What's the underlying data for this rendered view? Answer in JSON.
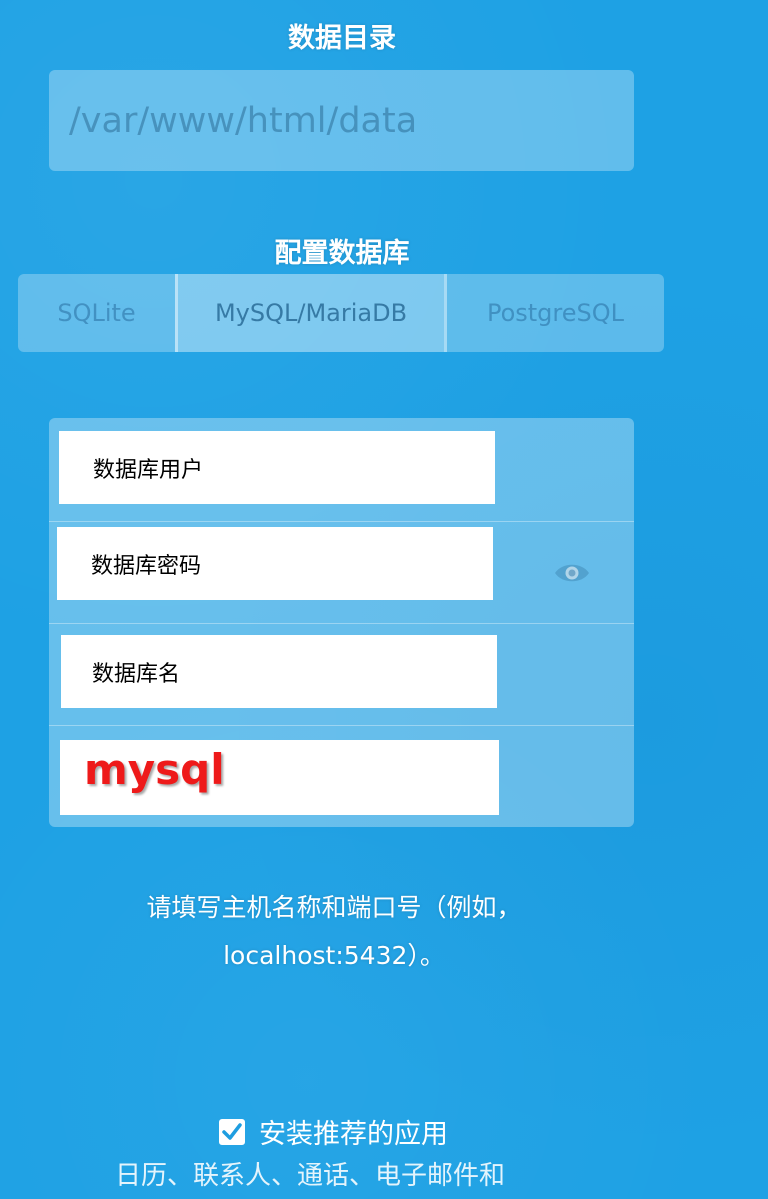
{
  "data_directory": {
    "title": "数据目录",
    "placeholder": "/var/www/html/data"
  },
  "database": {
    "title": "配置数据库",
    "tabs": [
      {
        "label": "SQLite",
        "active": false
      },
      {
        "label": "MySQL/MariaDB",
        "active": true
      },
      {
        "label": "PostgreSQL",
        "active": false
      }
    ],
    "fields": {
      "user_label": "数据库用户",
      "password_label": "数据库密码",
      "name_label": "数据库名",
      "host_value": "mysql"
    },
    "password_toggle_icon": "eye-icon"
  },
  "hint": {
    "line1": "请填写主机名称和端口号（例如，",
    "line2": "localhost:5432）。"
  },
  "recommended_apps": {
    "checked": true,
    "label": "安装推荐的应用",
    "description": "日历、联系人、通话、电子邮件和"
  }
}
